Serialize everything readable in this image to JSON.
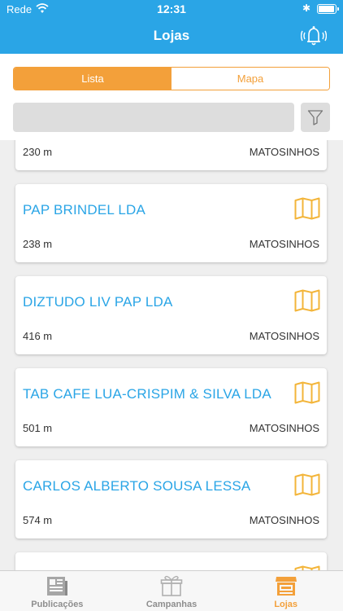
{
  "status": {
    "carrier": "Rede",
    "time": "12:31",
    "battery_level": 1.0
  },
  "nav": {
    "title": "Lojas"
  },
  "segments": {
    "list_label": "Lista",
    "map_label": "Mapa",
    "active": "Lista"
  },
  "search": {
    "placeholder": "",
    "value": ""
  },
  "stores": [
    {
      "name": "",
      "distance": "230 m",
      "city": "MATOSINHOS"
    },
    {
      "name": "PAP BRINDEL LDA",
      "distance": "238 m",
      "city": "MATOSINHOS"
    },
    {
      "name": "DIZTUDO LIV PAP LDA",
      "distance": "416 m",
      "city": "MATOSINHOS"
    },
    {
      "name": "TAB CAFE LUA-CRISPIM & SILVA LDA",
      "distance": "501 m",
      "city": "MATOSINHOS"
    },
    {
      "name": "CARLOS ALBERTO  SOUSA LESSA",
      "distance": "574 m",
      "city": "MATOSINHOS"
    }
  ],
  "tabs": [
    {
      "label": "Publicações",
      "icon": "newspaper-icon"
    },
    {
      "label": "Campanhas",
      "icon": "gift-icon"
    },
    {
      "label": "Lojas",
      "icon": "store-icon",
      "active": true
    }
  ],
  "colors": {
    "primary": "#2aa5e6",
    "accent": "#f3a03a",
    "background": "#efefef"
  }
}
